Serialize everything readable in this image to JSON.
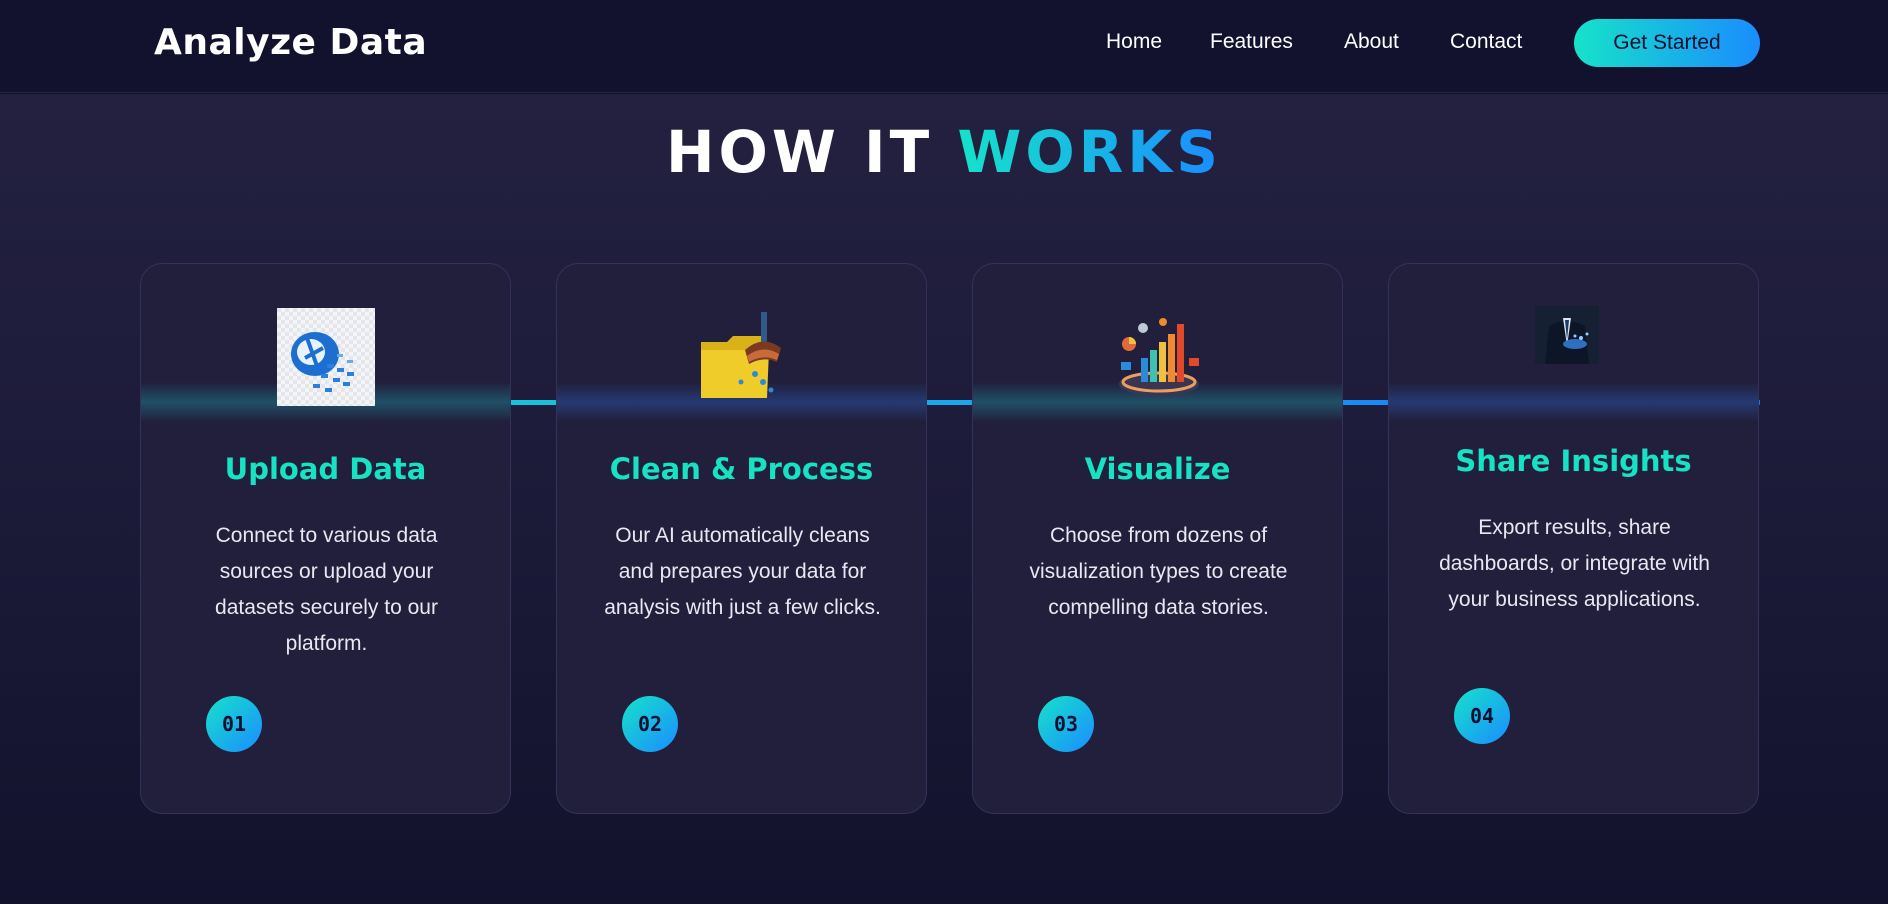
{
  "nav": {
    "brand": "Analyze Data",
    "links": [
      "Home",
      "Features",
      "About",
      "Contact"
    ],
    "cta": "Get Started"
  },
  "section": {
    "heading_main": "HOW IT",
    "heading_accent": "WORKS"
  },
  "steps": [
    {
      "icon": "cloud-upload-icon",
      "title": "Upload Data",
      "description": "Connect to various data sources or upload your datasets securely to our platform.",
      "number": "01"
    },
    {
      "icon": "folder-brush-icon",
      "title": "Clean & Process",
      "description": "Our AI automatically cleans and prepares your data for analysis with just a few clicks.",
      "number": "02"
    },
    {
      "icon": "bar-chart-icon",
      "title": "Visualize",
      "description": "Choose from dozens of visualization types to create compelling data stories.",
      "number": "03"
    },
    {
      "icon": "businessman-share-icon",
      "title": "Share Insights",
      "description": "Export results, share dashboards, or integrate with your business applications.",
      "number": "04"
    }
  ],
  "colors": {
    "accent_start": "#16e3c9",
    "accent_end": "#1a8cff",
    "title_color": "#17e2c3",
    "background": "#12112b"
  }
}
